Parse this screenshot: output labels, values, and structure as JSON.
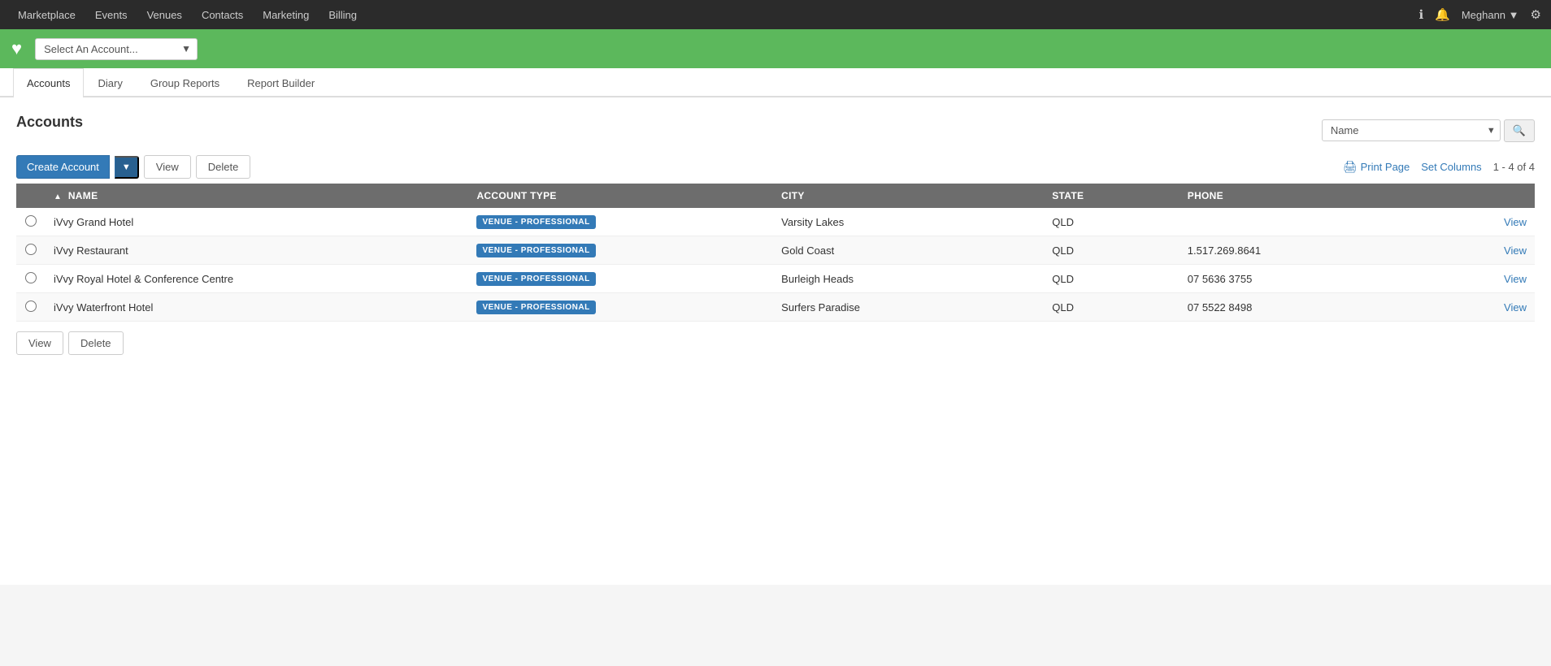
{
  "nav": {
    "items": [
      {
        "label": "Marketplace",
        "id": "marketplace"
      },
      {
        "label": "Events",
        "id": "events"
      },
      {
        "label": "Venues",
        "id": "venues"
      },
      {
        "label": "Contacts",
        "id": "contacts"
      },
      {
        "label": "Marketing",
        "id": "marketing"
      },
      {
        "label": "Billing",
        "id": "billing"
      }
    ],
    "user": "Meghann",
    "info_icon": "ℹ",
    "bell_icon": "🔔",
    "settings_icon": "⚙"
  },
  "green_bar": {
    "logo_icon": "♥",
    "account_select_placeholder": "Select An Account...",
    "account_select_arrow": "▼"
  },
  "tabs": [
    {
      "label": "Accounts",
      "id": "accounts",
      "active": true
    },
    {
      "label": "Diary",
      "id": "diary",
      "active": false
    },
    {
      "label": "Group Reports",
      "id": "group-reports",
      "active": false
    },
    {
      "label": "Report Builder",
      "id": "report-builder",
      "active": false
    }
  ],
  "page": {
    "title": "Accounts",
    "search": {
      "placeholder": "Name",
      "select_label": "Name",
      "select_arrow": "▼",
      "button_icon": "🔍"
    },
    "toolbar": {
      "create_label": "Create Account",
      "create_dropdown_arrow": "▼",
      "view_label": "View",
      "delete_label": "Delete",
      "print_label": "Print Page",
      "set_columns_label": "Set Columns",
      "record_count": "1 - 4 of 4"
    },
    "table": {
      "columns": [
        {
          "label": "",
          "id": "select"
        },
        {
          "label": "NAME",
          "id": "name",
          "sortable": true,
          "sorted": true,
          "sort_dir": "▲"
        },
        {
          "label": "ACCOUNT TYPE",
          "id": "account-type"
        },
        {
          "label": "CITY",
          "id": "city"
        },
        {
          "label": "STATE",
          "id": "state"
        },
        {
          "label": "PHONE",
          "id": "phone"
        },
        {
          "label": "",
          "id": "actions"
        }
      ],
      "rows": [
        {
          "name": "iVvy Grand Hotel",
          "account_type": "VENUE - PROFESSIONAL",
          "city": "Varsity Lakes",
          "state": "QLD",
          "phone": "",
          "view_label": "View"
        },
        {
          "name": "iVvy Restaurant",
          "account_type": "VENUE - PROFESSIONAL",
          "city": "Gold Coast",
          "state": "QLD",
          "phone": "1.517.269.8641",
          "view_label": "View"
        },
        {
          "name": "iVvy Royal Hotel & Conference Centre",
          "account_type": "VENUE - PROFESSIONAL",
          "city": "Burleigh Heads",
          "state": "QLD",
          "phone": "07 5636 3755",
          "view_label": "View"
        },
        {
          "name": "iVvy Waterfront Hotel",
          "account_type": "VENUE - PROFESSIONAL",
          "city": "Surfers Paradise",
          "state": "QLD",
          "phone": "07 5522 8498",
          "view_label": "View"
        }
      ]
    },
    "bottom_bar": {
      "view_label": "View",
      "delete_label": "Delete"
    }
  }
}
